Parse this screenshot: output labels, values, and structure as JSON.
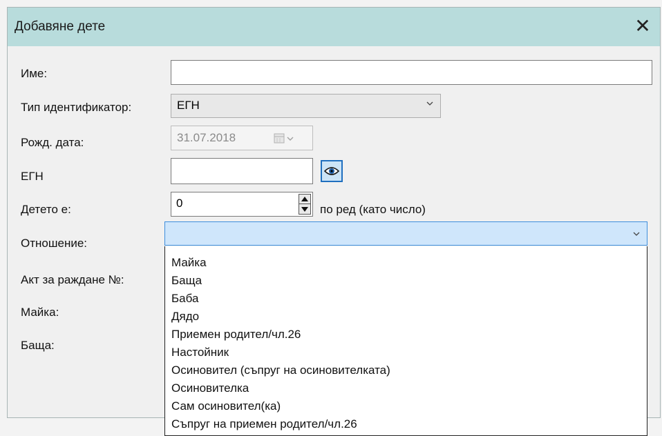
{
  "dialog": {
    "title": "Добавяне дете",
    "close_glyph": "✕"
  },
  "form": {
    "name_label": "Име:",
    "name_value": "",
    "id_type_label": "Тип идентификатор:",
    "id_type_value": "ЕГН",
    "birth_label": "Рожд. дата:",
    "birth_value": "31.07.2018",
    "egn_label": "ЕГН",
    "egn_value": "",
    "child_order_label": "Детето е:",
    "child_order_value": "0",
    "child_order_suffix": "по ред (като число)",
    "relation_label": "Отношение:",
    "relation_value": "",
    "birth_act_label": "Акт за раждане №:",
    "mother_label": "Майка:",
    "father_label": "Баща:"
  },
  "dropdown": {
    "options": [
      "Майка",
      "Баща",
      "Баба",
      "Дядо",
      "Приемен родител/чл.26",
      "Настойник",
      "Осиновител (съпруг на осиновителката)",
      "Осиновителка",
      "Сам осиновител(ка)",
      "Съпруг на приемен родител/чл.26"
    ]
  },
  "icons": {
    "calendar": "calendar-icon",
    "eye": "eye-icon",
    "chevron": "chevron-down-icon"
  },
  "colors": {
    "titlebar": "#b8dcdc",
    "selection": "#cfe6fb",
    "accent": "#1f6fbf"
  }
}
